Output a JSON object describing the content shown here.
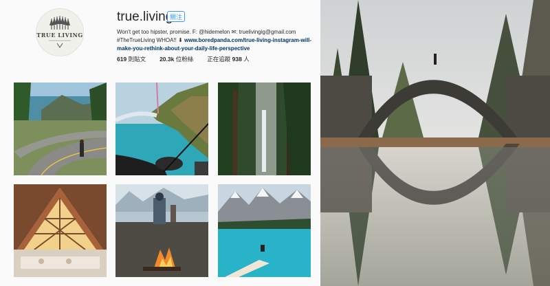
{
  "profile": {
    "username": "true.living",
    "follow_label": "關注",
    "bio_line1": "Won't get too hipster, promise. F: @hidemelon ✉: truelivingig@gmail.com",
    "bio_hashtag": "#TheTrueLiving WHOA!! ⬇",
    "bio_link": "www.boredpanda.com/true-living-instagram-will-make-you-rethink-about-your-daily-life-perspective",
    "logo_text": "TRUE LIVING",
    "logo_icon": "tree-logo-icon"
  },
  "stats": {
    "posts_count": "619",
    "posts_label": "則貼文",
    "followers_count": "20.3k",
    "followers_label": "位粉絲",
    "following_prefix": "正在追蹤",
    "following_count": "938",
    "following_label": "人"
  },
  "photos": [
    {
      "subject": "coastal road"
    },
    {
      "subject": "helicopter over coast"
    },
    {
      "subject": "forest waterfall"
    },
    {
      "subject": "a-frame cabin"
    },
    {
      "subject": "campfire lake"
    },
    {
      "subject": "mountain lake"
    }
  ],
  "colors": {
    "link": "#003569",
    "button": "#3897f0",
    "text": "#262626"
  }
}
